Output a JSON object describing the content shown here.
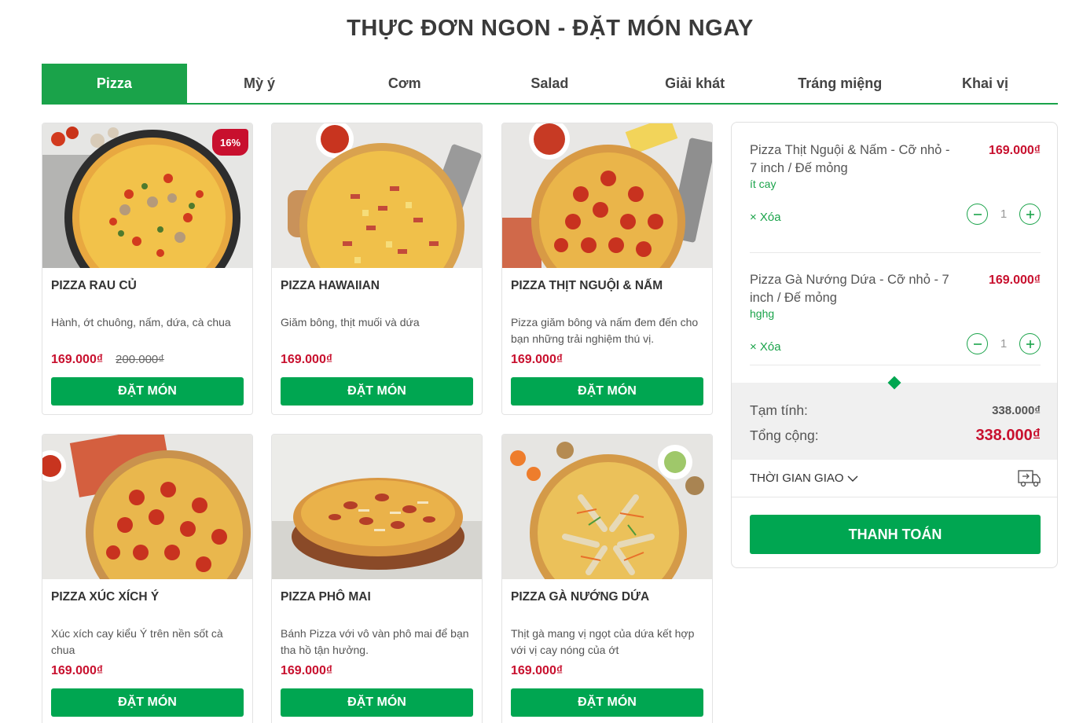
{
  "page": {
    "title": "THỰC ĐƠN NGON - ĐẶT MÓN NGAY"
  },
  "tabs": [
    "Pizza",
    "Mỳ ý",
    "Cơm",
    "Salad",
    "Giải khát",
    "Tráng miệng",
    "Khai vị"
  ],
  "active_tab": "Pizza",
  "products": [
    {
      "name": "PIZZA RAU CỦ",
      "desc": "Hành, ớt chuông, nấm, dứa, cà chua",
      "price": "169.000₫",
      "old_price": "200.000₫",
      "badge": "16%",
      "button": "ĐẶT MÓN",
      "image": "pizza-veggie"
    },
    {
      "name": "PIZZA HAWAIIAN",
      "desc": "Giăm bông, thịt muối và dứa",
      "price": "169.000₫",
      "button": "ĐẶT MÓN",
      "image": "pizza-hawaiian"
    },
    {
      "name": "PIZZA THỊT NGUỘI & NẤM",
      "desc": "Pizza giăm bông và nấm đem đến cho bạn những trải nghiệm thú vị.",
      "price": "169.000₫",
      "button": "ĐẶT MÓN",
      "image": "pizza-pepperoni"
    },
    {
      "name": "PIZZA XÚC XÍCH Ý",
      "desc": "Xúc xích cay kiểu Ý trên nền sốt cà chua",
      "price": "169.000₫",
      "button": "ĐẶT MÓN",
      "image": "pizza-sausage"
    },
    {
      "name": "PIZZA PHÔ MAI",
      "desc": "Bánh Pizza với vô vàn phô mai để bạn tha hồ tận hưởng.",
      "price": "169.000₫",
      "button": "ĐẶT MÓN",
      "image": "pizza-cheese"
    },
    {
      "name": "PIZZA GÀ NƯỚNG DỨA",
      "desc": "Thịt gà mang vị ngọt của dứa kết hợp với vị cay nóng của ớt",
      "price": "169.000₫",
      "button": "ĐẶT MÓN",
      "image": "pizza-chicken"
    }
  ],
  "cart": {
    "items": [
      {
        "name": "Pizza Thịt Nguội & Nấm - Cỡ nhỏ - 7 inch / Đế mỏng",
        "note": "ít cay",
        "price": "169.000₫",
        "qty": "1",
        "remove_label": "× Xóa"
      },
      {
        "name": "Pizza Gà Nướng Dứa - Cỡ nhỏ - 7 inch / Đế mỏng",
        "note": "hghg",
        "price": "169.000₫",
        "qty": "1",
        "remove_label": "× Xóa"
      }
    ],
    "subtotal_label": "Tạm tính:",
    "subtotal": "338.000₫",
    "total_label": "Tổng cộng:",
    "total": "338.000₫",
    "delivery_label": "THỜI GIAN GIAO",
    "checkout_label": "THANH TOÁN"
  },
  "colors": {
    "accent": "#00a651",
    "price": "#c8102e",
    "tab_active": "#1aa34a"
  }
}
